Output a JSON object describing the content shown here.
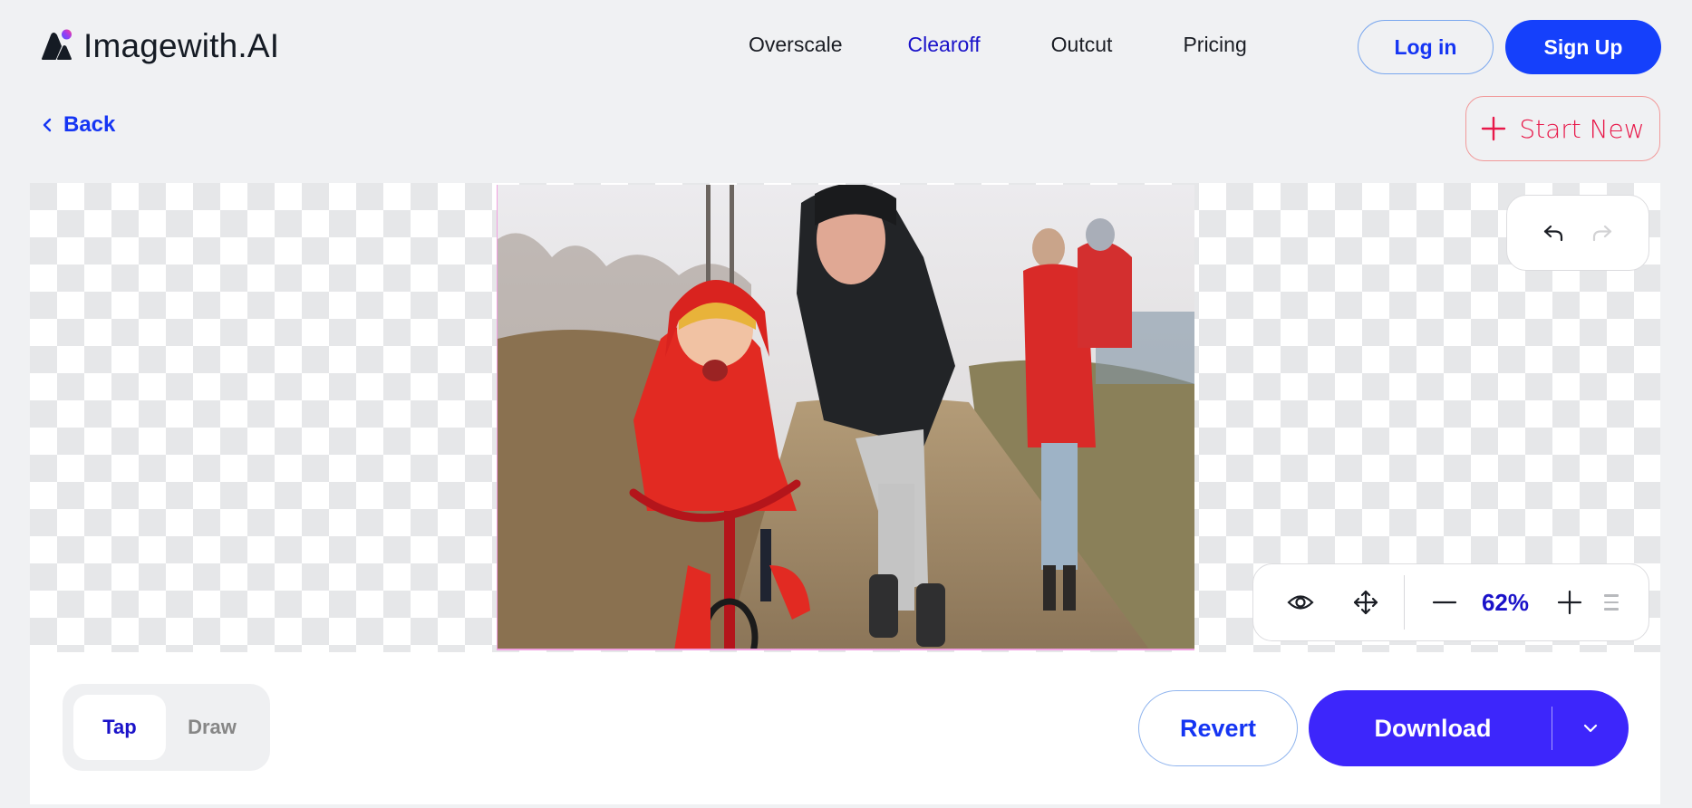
{
  "app": {
    "brand": "Imagewith.AI",
    "accent_color": "#1540fb",
    "active_nav_color": "#1a12c9",
    "danger_color": "#e8194a",
    "download_color": "#3d26fb"
  },
  "header": {
    "nav": [
      {
        "label": "Overscale",
        "active": false
      },
      {
        "label": "Clearoff",
        "active": true
      },
      {
        "label": "Outcut",
        "active": false
      },
      {
        "label": "Pricing",
        "active": false
      }
    ],
    "login_label": "Log in",
    "signup_label": "Sign Up"
  },
  "subheader": {
    "back_label": "Back",
    "start_new_label": "Start New"
  },
  "canvas": {
    "image_alt": "Father teaching laughing child in red jacket to ride a red balance bike on a dirt path, woman carrying toddler behind",
    "history": {
      "undo_icon": "undo-arrow-icon",
      "redo_icon": "redo-arrow-icon",
      "redo_enabled": false
    },
    "zoom_controls": {
      "preview_icon": "eye-icon",
      "pan_icon": "move-arrows-icon",
      "zoom_out_icon": "minus-icon",
      "zoom_level": "62%",
      "zoom_in_icon": "plus-icon",
      "drag_handle_icon": "drag-handle-icon"
    }
  },
  "bottom": {
    "modes": [
      {
        "label": "Tap",
        "active": true
      },
      {
        "label": "Draw",
        "active": false
      }
    ],
    "revert_label": "Revert",
    "download_label": "Download"
  }
}
